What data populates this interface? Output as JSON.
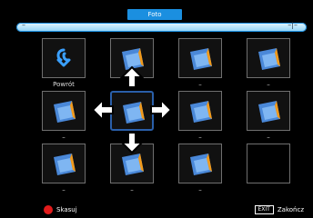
{
  "header": {
    "title": "Foto"
  },
  "path": {
    "left": "–",
    "right": "–|–"
  },
  "tiles": [
    {
      "label": "Powrót"
    },
    {
      "label": ""
    },
    {
      "label": "–"
    },
    {
      "label": "–"
    },
    {
      "label": "–"
    },
    {
      "label": ""
    },
    {
      "label": "–"
    },
    {
      "label": "–"
    },
    {
      "label": "–"
    },
    {
      "label": "–"
    },
    {
      "label": "–"
    },
    {
      "label": ""
    }
  ],
  "footer": {
    "delete_label": "Skasuj",
    "exit_key": "EXIT",
    "exit_label": "Zakończ"
  },
  "colors": {
    "accent": "#1b8fe0",
    "selection": "#2a5fa9",
    "delete": "#e21b1b"
  }
}
